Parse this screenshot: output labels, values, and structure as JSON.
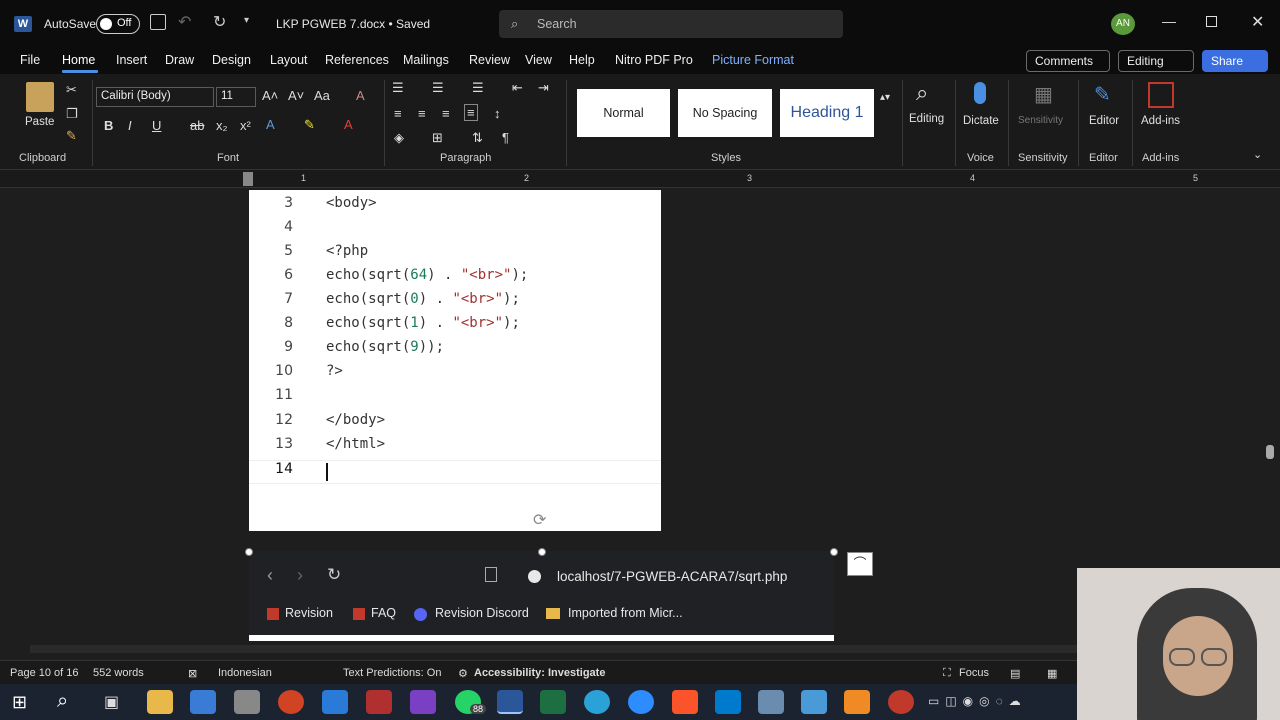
{
  "title_bar": {
    "app_icon": "word-icon",
    "autosave_label": "AutoSave",
    "autosave_state": "Off",
    "doc_title": "LKP PGWEB 7.docx • Saved",
    "search_placeholder": "Search",
    "avatar_initials": "AN"
  },
  "menu": {
    "items": [
      "File",
      "Home",
      "Insert",
      "Draw",
      "Design",
      "Layout",
      "References",
      "Mailings",
      "Review",
      "View",
      "Help",
      "Nitro PDF Pro",
      "Picture Format"
    ],
    "active": "Home",
    "comments_label": "Comments",
    "editing_label": "Editing",
    "share_label": "Share"
  },
  "ribbon": {
    "paste_label": "Paste",
    "font_name": "Calibri (Body)",
    "font_size": "11",
    "groups": [
      "Clipboard",
      "Font",
      "Paragraph",
      "Styles",
      "Voice",
      "Sensitivity",
      "Editor",
      "Add-ins"
    ],
    "styles": [
      "Normal",
      "No Spacing",
      "Heading 1"
    ],
    "editing_btn": "Editing",
    "dictate_btn": "Dictate",
    "sensitivity_btn": "Sensitivity",
    "editor_btn": "Editor",
    "addins_btn": "Add-ins"
  },
  "ruler": {
    "marks": [
      "1",
      "2",
      "3",
      "4",
      "5"
    ]
  },
  "document": {
    "lines": [
      {
        "num": "3",
        "code": "<body>"
      },
      {
        "num": "4",
        "code": ""
      },
      {
        "num": "5",
        "code": "<?php"
      },
      {
        "num": "6",
        "pre": "echo(sqrt(",
        "n": "64",
        "post": ") . ",
        "s": "\"<br>\"",
        "end": ");"
      },
      {
        "num": "7",
        "pre": "echo(sqrt(",
        "n": "0",
        "post": ") . ",
        "s": "\"<br>\"",
        "end": ");"
      },
      {
        "num": "8",
        "pre": "echo(sqrt(",
        "n": "1",
        "post": ") . ",
        "s": "\"<br>\"",
        "end": ");"
      },
      {
        "num": "9",
        "pre": "echo(sqrt(",
        "n": "9",
        "post": ")",
        "s": "",
        "end": ");"
      },
      {
        "num": "10",
        "code": "?>"
      },
      {
        "num": "11",
        "code": ""
      },
      {
        "num": "12",
        "code": "</body>"
      },
      {
        "num": "13",
        "code": "</html>"
      },
      {
        "num": "14",
        "code": ""
      }
    ]
  },
  "browser": {
    "url": "localhost/7-PGWEB-ACARA7/sqrt.php",
    "bookmarks": [
      "Revision",
      "FAQ",
      "Revision Discord",
      "Imported from Micr..."
    ]
  },
  "status_bar": {
    "page": "Page 10 of 16",
    "words": "552 words",
    "language": "Indonesian",
    "predictions": "Text Predictions: On",
    "accessibility": "Accessibility: Investigate",
    "focus": "Focus"
  },
  "taskbar": {
    "badge": "88"
  }
}
